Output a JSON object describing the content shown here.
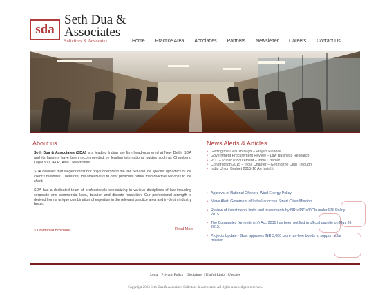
{
  "brand": {
    "mark": "sda",
    "name_line1": "Seth Dua &",
    "name_line2": "Associates",
    "tagline": "Solicitors & Advocates"
  },
  "nav": [
    "Home",
    "Practice Area",
    "Accolades",
    "Partners",
    "Newsletter",
    "Careers",
    "Contact Us"
  ],
  "about": {
    "title": "About us",
    "p1_firm": "Seth Dua & Associates (SDA)",
    "p1_rest": " is a leading Indian law firm head-quartered at New Delhi. SDA and its lawyers have been recommended by leading international guides such as Chambers, Legal 500, IFLR, Asia Law Profiles.",
    "p2": "SDA believes that lawyers must not only understand the law but also the specific dynamics of the client's business. Therefore, the objective is to offer proactive rather than reactive services to the client.",
    "p3": "SDA has a dedicated team of professionals specializing in various disciplines of law including corporate and commercial laws, taxation and dispute resolution. Our professional strength is derived from a unique combination of expertise in the relevant practice area and in-depth industry focus.",
    "download": "» Download Brochure",
    "read_more": "Read More"
  },
  "news": {
    "title": "News Alerts & Articles",
    "top": [
      "Getting the Deal Through – Project Finance",
      "Government Procurement Review – Law Business Research",
      "PLC – Public Procurement – India Chapter",
      "Construction 2015 – India Chapter – Getting the Deal Through",
      "India Union Budget 2015-16 An Insight"
    ],
    "bottom": [
      "Approval of National Offshore Wind Energy Policy",
      "News Alert: Governent of India Launches Smart Cities Mission",
      "Review of investments limits and investments by NRIs/PIOs/OCIs under FDI Policy 2015",
      "The Companies (Amendment) Act, 2015 has been notified in official gazette on May 26, 2015.",
      "Projects Update - Govt approves INR 3,000 crore tax-free bonds to support solar mission"
    ]
  },
  "footer": {
    "links": "Legal | Privacy Policy | Disclaimer | Useful Links | Updates",
    "copyright": "Copyright 2013 Seth Dua & Associates Solicitors & Advocates. All rights reserved gets reserved."
  }
}
